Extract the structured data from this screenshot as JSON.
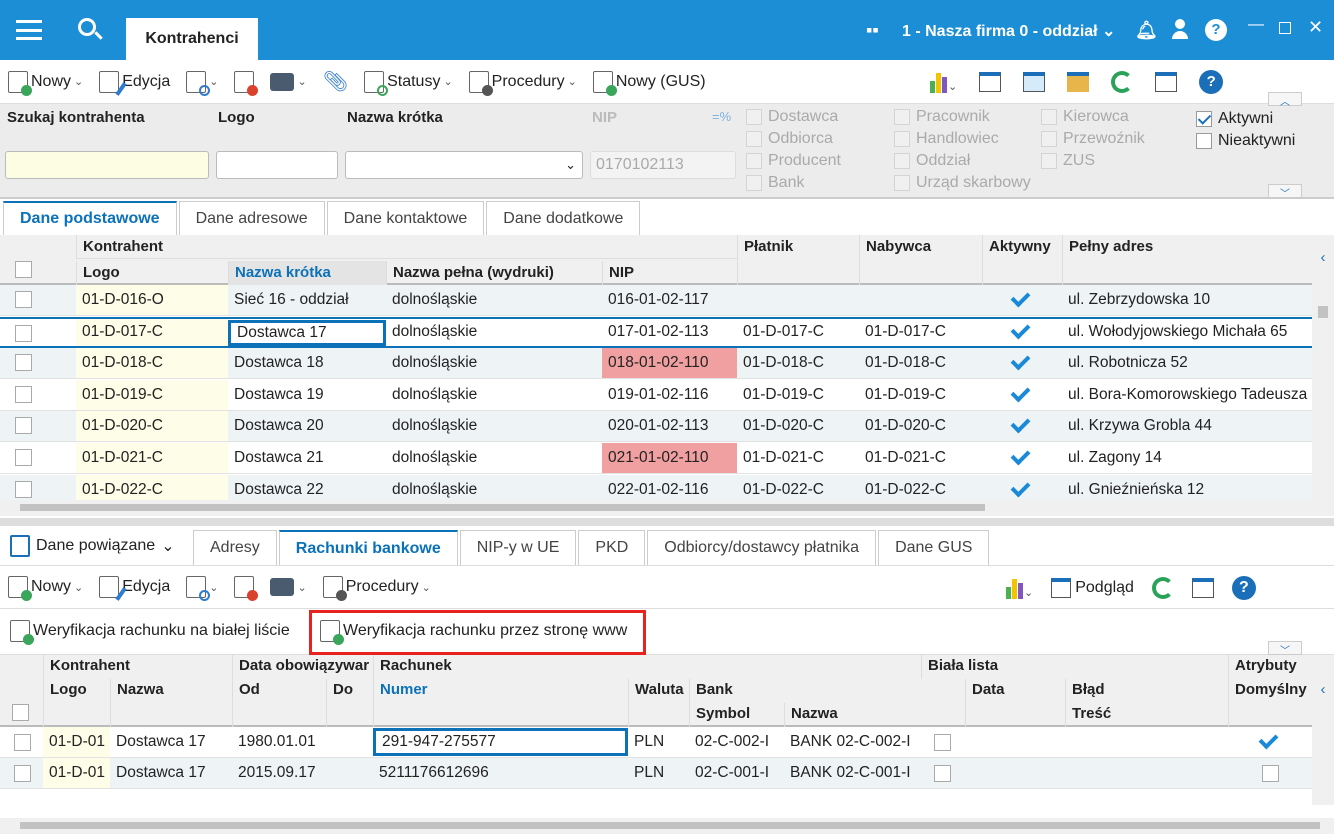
{
  "title": {
    "tab": "Kontrahenci",
    "company": "1 - Nasza firma 0 - oddział"
  },
  "toolbar": {
    "new": "Nowy",
    "edit": "Edycja",
    "statuses": "Statusy",
    "procedures": "Procedury",
    "new_gus": "Nowy (GUS)"
  },
  "filter": {
    "search_label": "Szukaj kontrahenta",
    "logo_label": "Logo",
    "short_name_label": "Nazwa krótka",
    "nip_label": "NIP",
    "nip_value": "0170102113",
    "nip_mode": "=%",
    "types": [
      [
        "Dostawca",
        "Odbiorca",
        "Producent",
        "Bank"
      ],
      [
        "Pracownik",
        "Handlowiec",
        "Oddział",
        "Urząd skarbowy"
      ],
      [
        "Kierowca",
        "Przewoźnik",
        "ZUS"
      ]
    ],
    "active": "Aktywni",
    "inactive": "Nieaktywni",
    "active_checked": true,
    "inactive_checked": false
  },
  "tabs": [
    "Dane podstawowe",
    "Dane adresowe",
    "Dane kontaktowe",
    "Dane dodatkowe"
  ],
  "grid": {
    "group": "Kontrahent",
    "cols": [
      "Logo",
      "Nazwa krótka",
      "Nazwa pełna (wydruki)",
      "NIP",
      "Płatnik",
      "Nabywca",
      "Aktywny",
      "Pełny adres"
    ],
    "rows": [
      [
        "01-D-016-O",
        "Sieć 16 - oddział",
        "dolnośląskie",
        "016-01-02-117",
        "",
        "",
        true,
        "ul. Zebrzydowska 10"
      ],
      [
        "01-D-017-C",
        "Dostawca 17",
        "dolnośląskie",
        "017-01-02-113",
        "01-D-017-C",
        "01-D-017-C",
        true,
        "ul. Wołodyjowskiego Michała 65"
      ],
      [
        "01-D-018-C",
        "Dostawca 18",
        "dolnośląskie",
        "018-01-02-110",
        "01-D-018-C",
        "01-D-018-C",
        true,
        "ul. Robotnicza 52"
      ],
      [
        "01-D-019-C",
        "Dostawca 19",
        "dolnośląskie",
        "019-01-02-116",
        "01-D-019-C",
        "01-D-019-C",
        true,
        "ul. Bora-Komorowskiego Tadeusza"
      ],
      [
        "01-D-020-C",
        "Dostawca 20",
        "dolnośląskie",
        "020-01-02-113",
        "01-D-020-C",
        "01-D-020-C",
        true,
        "ul. Krzywa Grobla 44"
      ],
      [
        "01-D-021-C",
        "Dostawca 21",
        "dolnośląskie",
        "021-01-02-110",
        "01-D-021-C",
        "01-D-021-C",
        true,
        "ul. Zagony 14"
      ],
      [
        "01-D-022-C",
        "Dostawca 22",
        "dolnośląskie",
        "022-01-02-116",
        "01-D-022-C",
        "01-D-022-C",
        true,
        "ul. Gnieźnieńska 12"
      ]
    ],
    "invalid_nip_rows": [
      2,
      5
    ],
    "selected_row": 1
  },
  "related": {
    "label": "Dane powiązane",
    "tabs": [
      "Adresy",
      "Rachunki bankowe",
      "NIP-y w UE",
      "PKD",
      "Odbiorcy/dostawcy płatnika",
      "Dane GUS"
    ],
    "active_tab": 1
  },
  "toolbar2": {
    "new": "Nowy",
    "edit": "Edycja",
    "procedures": "Procedury",
    "preview": "Podgląd"
  },
  "actions": {
    "whitelist": "Weryfikacja rachunku na białej liście",
    "www": "Weryfikacja rachunku przez stronę www"
  },
  "grid2": {
    "h": {
      "kontrahent": "Kontrahent",
      "logo": "Logo",
      "nazwa": "Nazwa",
      "data": "Data obowiązywar",
      "od": "Od",
      "do": "Do",
      "rachunek": "Rachunek",
      "numer": "Numer",
      "waluta": "Waluta",
      "bank": "Bank",
      "symbol": "Symbol",
      "bnazwa": "Nazwa",
      "biala": "Biała lista",
      "bdata": "Data",
      "blad": "Błąd",
      "tresc": "Treść",
      "atrybuty": "Atrybuty",
      "domyslny": "Domyślny"
    },
    "rows": [
      [
        "01-D-01",
        "Dostawca 17",
        "1980.01.01",
        "",
        "291-947-275577",
        "PLN",
        "02-C-002-I",
        "BANK 02-C-002-I",
        true
      ],
      [
        "01-D-01",
        "Dostawca 17",
        "2015.09.17",
        "",
        "5211176612696",
        "PLN",
        "02-C-001-I",
        "BANK 02-C-001-I",
        false
      ]
    ]
  },
  "colors": {
    "accent": "#1b8ed6",
    "invalid": "#f0a0a0",
    "highlight": "#e8231f"
  }
}
